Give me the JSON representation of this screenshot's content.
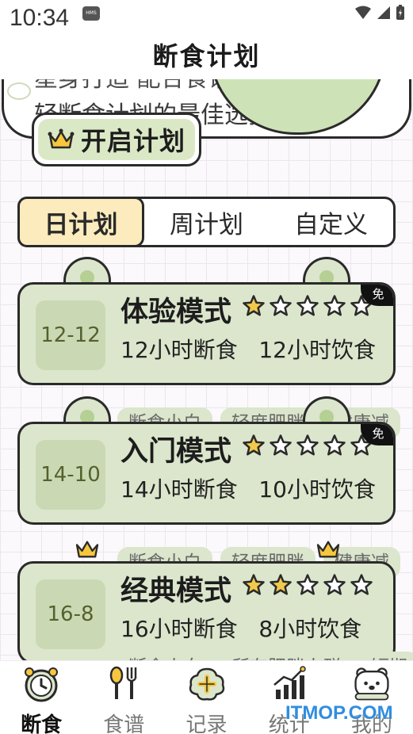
{
  "status_bar": {
    "time": "10:34",
    "hms_label": "HMS"
  },
  "header": {
    "title": "断食计划"
  },
  "banner": {
    "text_line1": "星身打造 配合食谱",
    "text_line2": "轻断食计划的最佳选择",
    "start_button_label": "开启计划"
  },
  "tabs": [
    {
      "label": "日计划",
      "active": true
    },
    {
      "label": "周计划",
      "active": false
    },
    {
      "label": "自定义",
      "active": false
    }
  ],
  "plans": [
    {
      "badge": "12-12",
      "title": "体验模式",
      "stars": 1,
      "max_stars": 5,
      "fast": "12小时断食",
      "eat": "12小时饮食",
      "free_label": "免",
      "tags": []
    },
    {
      "badge": "14-10",
      "title": "入门模式",
      "stars": 1,
      "max_stars": 5,
      "fast": "14小时断食",
      "eat": "10小时饮食",
      "free_label": "免",
      "tags": [
        "断食小白",
        "轻度肥胖",
        "健康减"
      ]
    },
    {
      "badge": "16-8",
      "title": "经典模式",
      "stars": 2,
      "max_stars": 5,
      "fast": "16小时断食",
      "eat": "8小时饮食",
      "free_label": "",
      "tags": [
        "断食小白",
        "轻度肥胖",
        "健康减"
      ]
    },
    {
      "tags": [
        "断食小白",
        "所有肥胖人群",
        "短期"
      ]
    }
  ],
  "bottom_nav": [
    {
      "label": "断食",
      "icon": "clock-icon",
      "active": true
    },
    {
      "label": "食谱",
      "icon": "utensils-icon",
      "active": false
    },
    {
      "label": "记录",
      "icon": "record-plus-icon",
      "active": false
    },
    {
      "label": "统计",
      "icon": "stats-chart-icon",
      "active": false
    },
    {
      "label": "我的",
      "icon": "profile-bear-icon",
      "active": false
    }
  ],
  "watermark": "ITMOP.COM",
  "colors": {
    "card_green": "#dbe6cc",
    "badge_green": "#cad9b3",
    "active_tab": "#fcebbd",
    "star": "#f2c94c",
    "watermark": "#2f8de0"
  }
}
